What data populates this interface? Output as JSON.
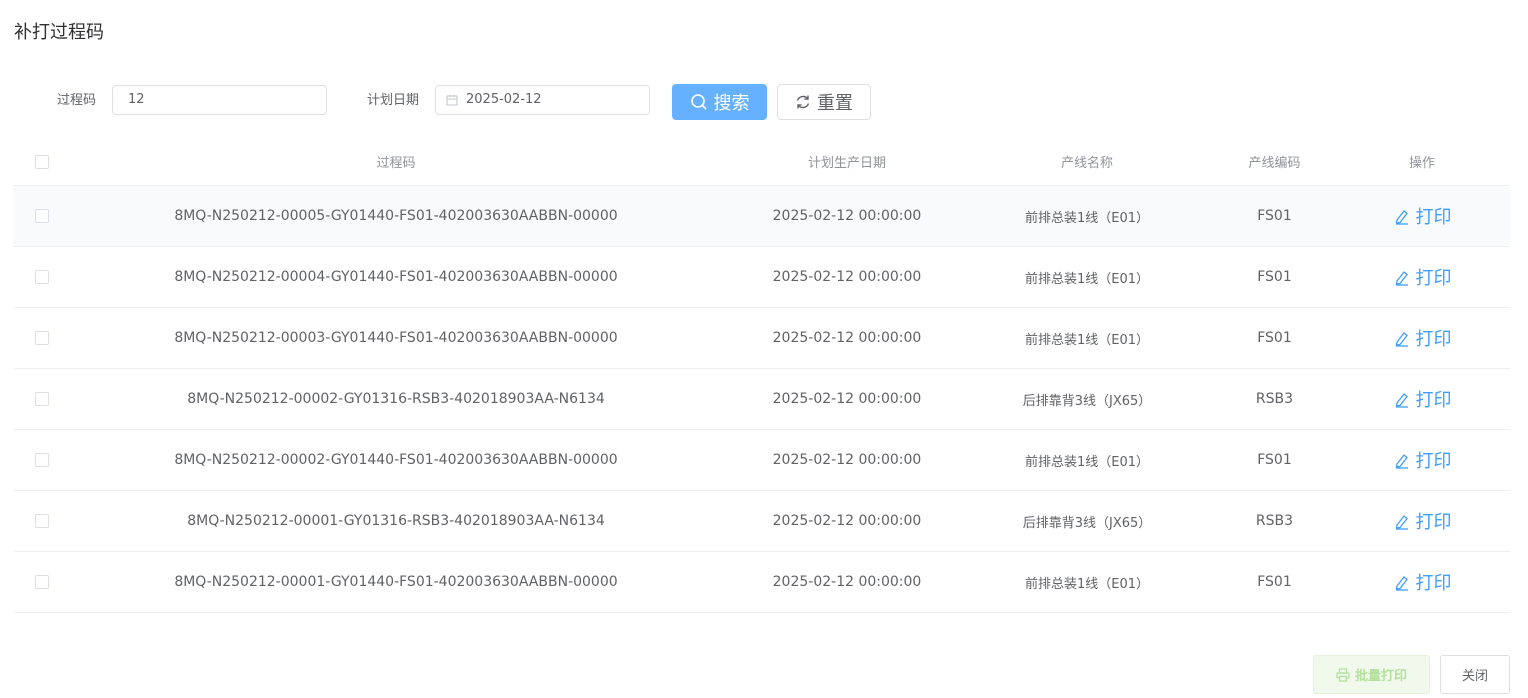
{
  "dialog": {
    "title": "补打过程码"
  },
  "search": {
    "code_label": "过程码",
    "code_value": "12",
    "date_label": "计划日期",
    "date_value": "2025-02-12",
    "search_label": "搜索",
    "reset_label": "重置"
  },
  "table": {
    "headers": {
      "code": "过程码",
      "date": "计划生产日期",
      "line_name": "产线名称",
      "line_code": "产线编码",
      "operation": "操作"
    },
    "rows": [
      {
        "code": "8MQ-N250212-00005-GY01440-FS01-402003630AABBN-00000",
        "date": "2025-02-12 00:00:00",
        "line_name": "前排总装1线（E01）",
        "line_code": "FS01",
        "action": "打印"
      },
      {
        "code": "8MQ-N250212-00004-GY01440-FS01-402003630AABBN-00000",
        "date": "2025-02-12 00:00:00",
        "line_name": "前排总装1线（E01）",
        "line_code": "FS01",
        "action": "打印"
      },
      {
        "code": "8MQ-N250212-00003-GY01440-FS01-402003630AABBN-00000",
        "date": "2025-02-12 00:00:00",
        "line_name": "前排总装1线（E01）",
        "line_code": "FS01",
        "action": "打印"
      },
      {
        "code": "8MQ-N250212-00002-GY01316-RSB3-402018903AA-N6134",
        "date": "2025-02-12 00:00:00",
        "line_name": "后排靠背3线（JX65）",
        "line_code": "RSB3",
        "action": "打印"
      },
      {
        "code": "8MQ-N250212-00002-GY01440-FS01-402003630AABBN-00000",
        "date": "2025-02-12 00:00:00",
        "line_name": "前排总装1线（E01）",
        "line_code": "FS01",
        "action": "打印"
      },
      {
        "code": "8MQ-N250212-00001-GY01316-RSB3-402018903AA-N6134",
        "date": "2025-02-12 00:00:00",
        "line_name": "后排靠背3线（JX65）",
        "line_code": "RSB3",
        "action": "打印"
      },
      {
        "code": "8MQ-N250212-00001-GY01440-FS01-402003630AABBN-00000",
        "date": "2025-02-12 00:00:00",
        "line_name": "前排总装1线（E01）",
        "line_code": "FS01",
        "action": "打印"
      }
    ]
  },
  "footer": {
    "batch_print_label": "批量打印",
    "close_label": "关闭"
  },
  "colors": {
    "primary": "#409eff",
    "search_bg": "#66b1ff",
    "success_light": "#f0f9eb",
    "border": "#ebeef5"
  },
  "icons": {
    "search": "search-icon",
    "reset": "refresh-icon",
    "calendar": "calendar-icon",
    "edit": "edit-icon",
    "printer": "printer-icon"
  }
}
